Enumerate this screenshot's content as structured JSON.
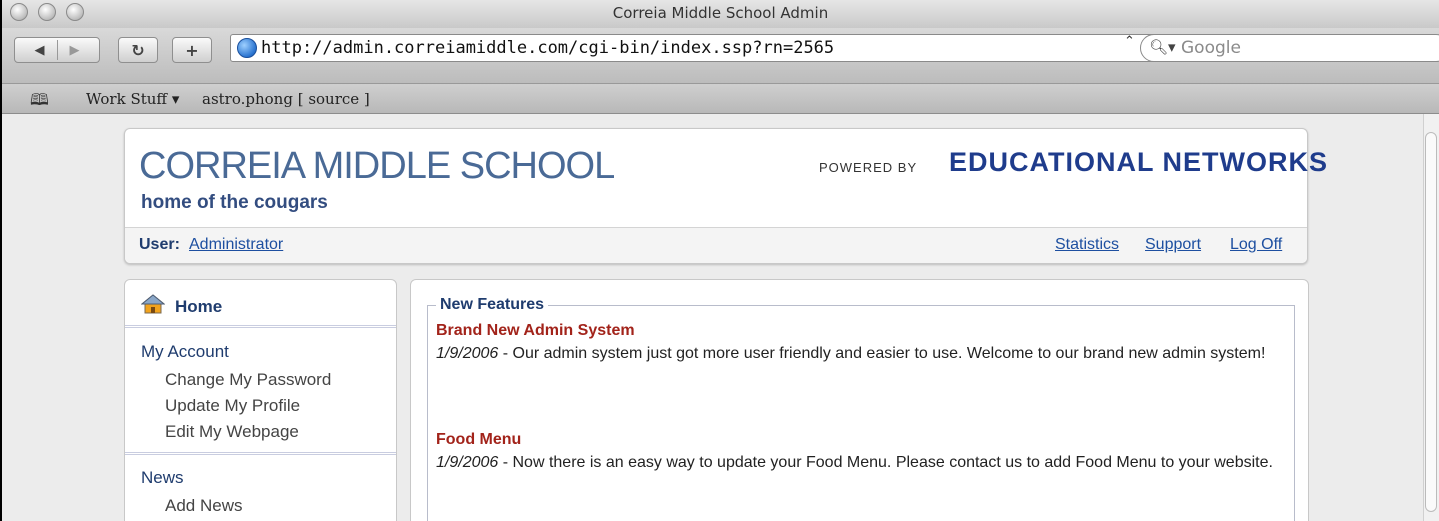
{
  "window": {
    "title": "Correia Middle School Admin"
  },
  "toolbar": {
    "back_icon": "back-arrow-icon",
    "forward_icon": "forward-arrow-icon",
    "reload_icon": "reload-icon",
    "add_bookmark_icon": "plus-icon",
    "url": "http://admin.correiamiddle.com/cgi-bin/index.ssp?rn=2565",
    "search_placeholder": "Google"
  },
  "bookmarks": {
    "items": [
      "Work Stuff ▾",
      "astro.phong [ source ]"
    ]
  },
  "header": {
    "school_name": "CORREIA MIDDLE SCHOOL",
    "tagline": "home of the cougars",
    "powered_by": "POWERED BY",
    "vendor": "EDUCATIONAL NETWORKS",
    "user_label": "User:",
    "user_name": "Administrator",
    "links": [
      "Statistics",
      "Support",
      "Log Off"
    ]
  },
  "sidebar": {
    "home": "Home",
    "sections": [
      {
        "title": "My Account",
        "links": [
          "Change My Password",
          "Update My Profile",
          "Edit My Webpage"
        ]
      },
      {
        "title": "News",
        "links": [
          "Add News"
        ]
      }
    ]
  },
  "main": {
    "legend": "New Features",
    "features": [
      {
        "title": "Brand New Admin System",
        "date": "1/9/2006",
        "text": " - Our admin system just got more user friendly and easier to use. Welcome to our brand new admin system!"
      },
      {
        "title": "Food Menu",
        "date": "1/9/2006",
        "text": " - Now there is an easy way to update your Food Menu. Please contact us to add Food Menu to your website."
      }
    ]
  },
  "colors": {
    "school_blue": "#4a6a96",
    "link_blue": "#1d4fa0",
    "feature_red": "#a2231a",
    "heading_navy": "#1f3c6e"
  }
}
